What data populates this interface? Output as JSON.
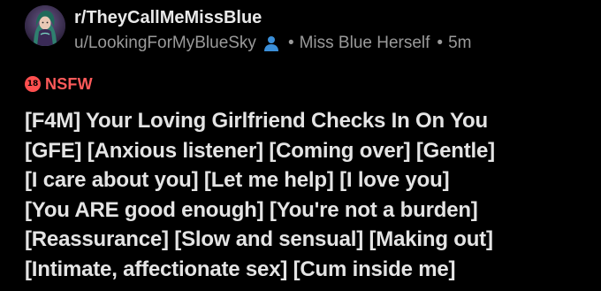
{
  "header": {
    "subreddit": "r/TheyCallMeMissBlue",
    "username": "u/LookingForMyBlueSky",
    "user_icon": "user-icon",
    "flair": "Miss Blue Herself",
    "time": "5m"
  },
  "nsfw": {
    "icon_text": "18",
    "label": "NSFW",
    "color": "#ff4f4f"
  },
  "post": {
    "title_lines": [
      "[F4M] Your Loving Girlfriend Checks In On You",
      "[GFE] [Anxious listener] [Coming over] [Gentle]",
      "[I care about you] [Let me help] [I love you]",
      "[You ARE good enough] [You're not a burden]",
      "[Reassurance] [Slow and sensual] [Making out]",
      "[Intimate, affectionate sex] [Cum inside me]"
    ]
  },
  "colors": {
    "background": "#000000",
    "accent_user_icon": "#3b8fd9",
    "text_primary": "#e8e8e8",
    "text_secondary": "#9a9a9a"
  }
}
